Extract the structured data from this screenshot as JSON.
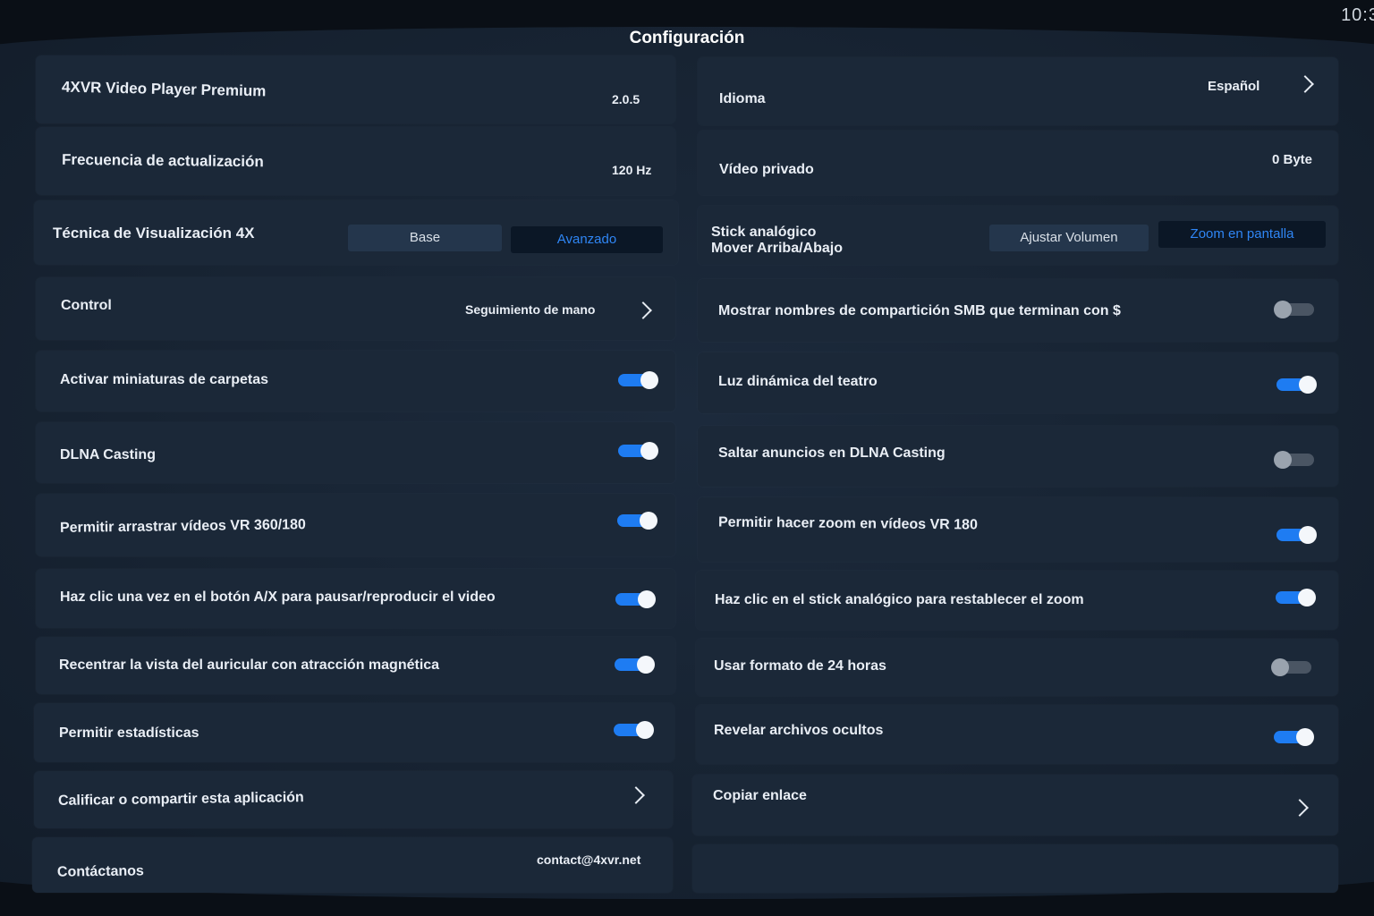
{
  "status": {
    "time": "10:3"
  },
  "title": "Configuración",
  "left": {
    "app_name": "4XVR Video Player Premium",
    "app_version": "2.0.5",
    "refresh_label": "Frecuencia de actualización",
    "refresh_value": "120 Hz",
    "technique_label": "Técnica de Visualización 4X",
    "technique_options": [
      "Base",
      "Avanzado"
    ],
    "technique_selected": "Avanzado",
    "control_label": "Control",
    "control_value": "Seguimiento de mano",
    "folder_thumbs": "Activar miniaturas de carpetas",
    "dlna": "DLNA Casting",
    "drag_vr": "Permitir arrastrar vídeos VR 360/180",
    "click_ax": "Haz clic una vez en el botón A/X para pausar/reproducir el video",
    "recenter": "Recentrar la vista del auricular con atracción magnética",
    "stats": "Permitir estadísticas",
    "rate": "Calificar o compartir esta aplicación",
    "contact_label": "Contáctanos",
    "contact_value": "contact@4xvr.net"
  },
  "right": {
    "language_label": "Idioma",
    "language_value": "Español",
    "private_label": "Vídeo privado",
    "private_value": "0 Byte",
    "stick_label_1": "Stick analógico",
    "stick_label_2": "Mover Arriba/Abajo",
    "stick_options": [
      "Ajustar Volumen",
      "Zoom en pantalla"
    ],
    "stick_selected": "Zoom en pantalla",
    "smb": "Mostrar nombres de compartición SMB que terminan con $",
    "theater": "Luz dinámica del teatro",
    "skip_ads": "Saltar anuncios en DLNA Casting",
    "zoom_vr180": "Permitir hacer zoom en vídeos VR 180",
    "reset_zoom": "Haz clic en el stick analógico para restablecer el zoom",
    "format24": "Usar formato de 24 horas",
    "hidden_files": "Revelar archivos ocultos",
    "copy_link": "Copiar enlace"
  },
  "toggles": {
    "folder_thumbs": true,
    "dlna": true,
    "drag_vr": true,
    "click_ax": true,
    "recenter": true,
    "stats": true,
    "smb": false,
    "theater": true,
    "skip_ads": false,
    "zoom_vr180": true,
    "reset_zoom": true,
    "format24": false,
    "hidden_files": true
  },
  "colors": {
    "accent": "#1e7cf2",
    "card": "#1b2838",
    "toggle_off": "#4a5563"
  }
}
